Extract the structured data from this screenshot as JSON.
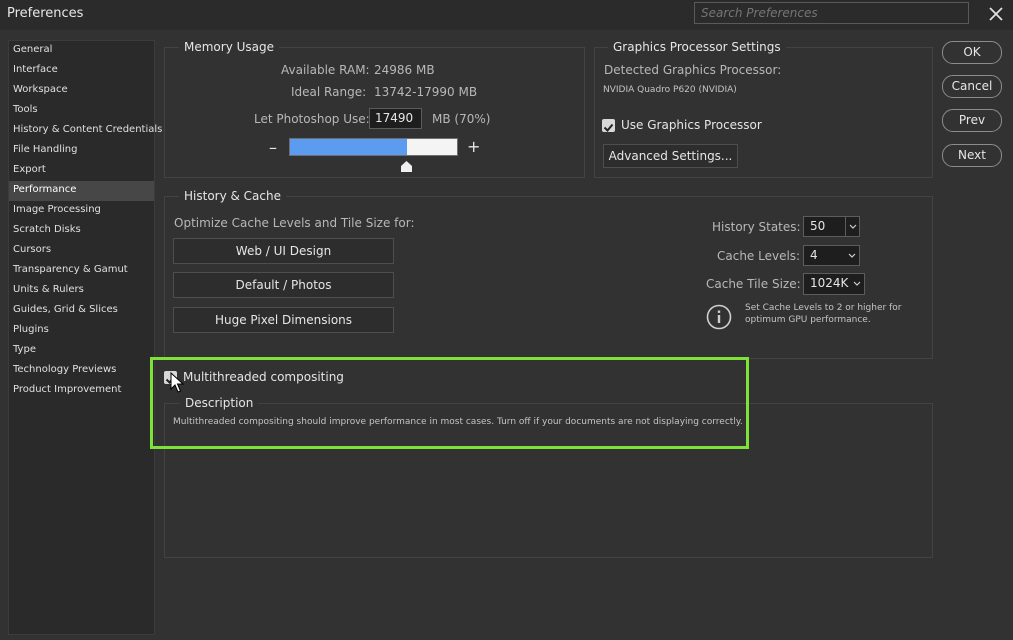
{
  "window": {
    "title": "Preferences"
  },
  "search": {
    "placeholder": "Search Preferences"
  },
  "sidebar": {
    "items": [
      {
        "label": "General"
      },
      {
        "label": "Interface"
      },
      {
        "label": "Workspace"
      },
      {
        "label": "Tools"
      },
      {
        "label": "History & Content Credentials"
      },
      {
        "label": "File Handling"
      },
      {
        "label": "Export"
      },
      {
        "label": "Performance",
        "active": true
      },
      {
        "label": "Image Processing"
      },
      {
        "label": "Scratch Disks"
      },
      {
        "label": "Cursors"
      },
      {
        "label": "Transparency & Gamut"
      },
      {
        "label": "Units & Rulers"
      },
      {
        "label": "Guides, Grid & Slices"
      },
      {
        "label": "Plugins"
      },
      {
        "label": "Type"
      },
      {
        "label": "Technology Previews"
      },
      {
        "label": "Product Improvement"
      }
    ]
  },
  "memory": {
    "legend": "Memory Usage",
    "available_label": "Available RAM:",
    "available_value": "24986 MB",
    "ideal_label": "Ideal Range:",
    "ideal_value": "13742-17990 MB",
    "use_label": "Let Photoshop Use:",
    "use_value": "17490",
    "use_unit": "MB (70%)",
    "slider_fraction": 0.7,
    "minus": "–",
    "plus": "+"
  },
  "gpu": {
    "legend": "Graphics Processor Settings",
    "detected_label": "Detected Graphics Processor:",
    "detected_value": "NVIDIA Quadro P620 (NVIDIA)",
    "use_gpu_label": "Use Graphics Processor",
    "use_gpu_checked": true,
    "advanced_label": "Advanced Settings..."
  },
  "history_cache": {
    "legend": "History & Cache",
    "optimize_label": "Optimize Cache Levels and Tile Size for:",
    "web_label": "Web / UI Design",
    "default_label": "Default / Photos",
    "huge_label": "Huge Pixel Dimensions",
    "history_states_label": "History States:",
    "history_states_value": "50",
    "cache_levels_label": "Cache Levels:",
    "cache_levels_value": "4",
    "tile_size_label": "Cache Tile Size:",
    "tile_size_value": "1024K",
    "info_line1": "Set Cache Levels to 2 or higher for",
    "info_line2": "optimum GPU performance."
  },
  "options": {
    "multithreaded_label": "Multithreaded compositing",
    "multithreaded_checked": true
  },
  "description": {
    "legend": "Description",
    "text": "Multithreaded compositing should improve performance in most cases. Turn off if your documents are not displaying correctly."
  },
  "buttons": {
    "ok": "OK",
    "cancel": "Cancel",
    "prev": "Prev",
    "next": "Next"
  },
  "colors": {
    "highlight": "#7de33a",
    "slider_fill": "#5b9cf1",
    "background": "#323232"
  }
}
